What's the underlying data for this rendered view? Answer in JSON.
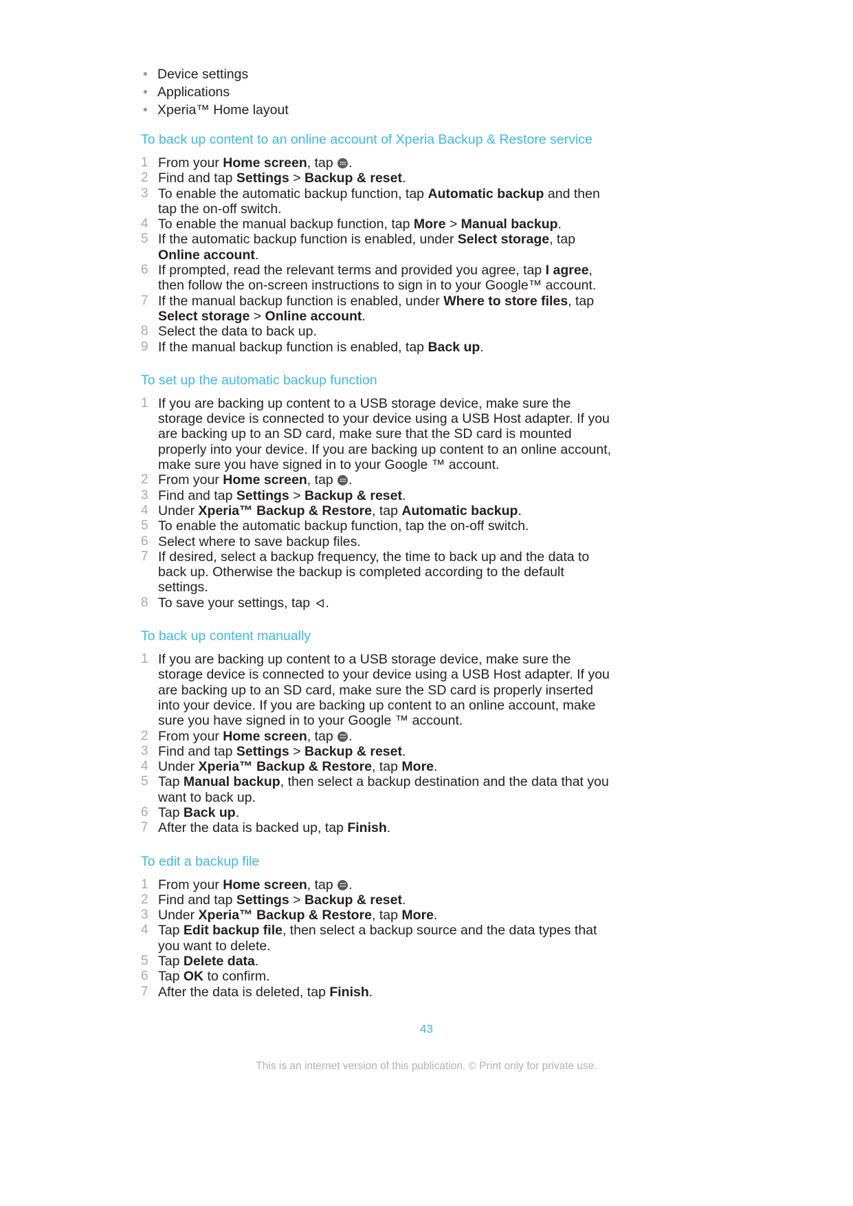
{
  "bullets": [
    "Device settings",
    "Applications",
    "Xperia™ Home layout"
  ],
  "sections": [
    {
      "heading": "To back up content to an online account of Xperia Backup & Restore service",
      "steps": [
        {
          "num": "1",
          "html": "From your <b>Home screen</b>, tap <span class=\"apps-icon\" data-name=\"apps-tray-icon\" data-interactable=\"false\"><i></i><i></i><i></i><i></i><i></i><i></i></span>."
        },
        {
          "num": "2",
          "html": "Find and tap <b>Settings</b> <span class=\"gt\">&gt;</span> <b>Backup &amp; reset</b>."
        },
        {
          "num": "3",
          "html": "To enable the automatic backup function, tap <b>Automatic backup</b> and then tap the on-off switch."
        },
        {
          "num": "4",
          "html": "To enable the manual backup function, tap <b>More</b> <span class=\"gt\">&gt;</span> <b>Manual backup</b>."
        },
        {
          "num": "5",
          "html": "If the automatic backup function is enabled, under <b>Select storage</b>, tap <b>Online account</b>."
        },
        {
          "num": "6",
          "html": "If prompted, read the relevant terms and provided you agree, tap <b>I agree</b>, then follow the on-screen instructions to sign in to your Google™ account."
        },
        {
          "num": "7",
          "html": "If the manual backup function is enabled, under <b>Where to store files</b>, tap <b>Select storage</b> <span class=\"gt\">&gt;</span> <b>Online account</b>."
        },
        {
          "num": "8",
          "html": "Select the data to back up."
        },
        {
          "num": "9",
          "html": "If the manual backup function is enabled, tap <b>Back up</b>."
        }
      ]
    },
    {
      "heading": "To set up the automatic backup function",
      "steps": [
        {
          "num": "1",
          "html": "If you are backing up content to a USB storage device, make sure the storage device is connected to your device using a USB Host adapter. If you are backing up to an SD card, make sure that the SD card is mounted properly into your device. If you are backing up content to an online account, make sure you have signed in to your Google ™ account."
        },
        {
          "num": "2",
          "html": "From your <b>Home screen</b>, tap <span class=\"apps-icon\" data-name=\"apps-tray-icon\" data-interactable=\"false\"><i></i><i></i><i></i><i></i><i></i><i></i></span>."
        },
        {
          "num": "3",
          "html": "Find and tap <b>Settings</b> <span class=\"gt\">&gt;</span> <b>Backup &amp; reset</b>."
        },
        {
          "num": "4",
          "html": "Under <b>Xperia™ Backup &amp; Restore</b>, tap <b>Automatic backup</b>."
        },
        {
          "num": "5",
          "html": "To enable the automatic backup function, tap the on-off switch."
        },
        {
          "num": "6",
          "html": "Select where to save backup files."
        },
        {
          "num": "7",
          "html": "If desired, select a backup frequency, the time to back up and the data to back up. Otherwise the backup is completed according to the default settings."
        },
        {
          "num": "8",
          "html": "To save your settings, tap <svg class=\"back-icon\" data-name=\"back-arrow-icon\" data-interactable=\"false\" width=\"15\" height=\"15\" viewBox=\"0 0 15 15\"><path d=\"M12.2 2.2 L2.6 7.5 L12.2 12.8 Z\" fill=\"none\" stroke=\"#231f20\" stroke-width=\"1.3\" stroke-linejoin=\"round\"/></svg>."
        }
      ]
    },
    {
      "heading": "To back up content manually",
      "steps": [
        {
          "num": "1",
          "html": "If you are backing up content to a USB storage device, make sure the storage device is connected to your device using a USB Host adapter. If you are backing up to an SD card, make sure the SD card is properly inserted into your device. If you are backing up content to an online account, make sure you have signed in to your Google ™ account."
        },
        {
          "num": "2",
          "html": "From your <b>Home screen</b>, tap <span class=\"apps-icon\" data-name=\"apps-tray-icon\" data-interactable=\"false\"><i></i><i></i><i></i><i></i><i></i><i></i></span>."
        },
        {
          "num": "3",
          "html": "Find and tap <b>Settings</b> <span class=\"gt\">&gt;</span> <b>Backup &amp; reset</b>."
        },
        {
          "num": "4",
          "html": "Under <b>Xperia™ Backup &amp; Restore</b>, tap <b>More</b>."
        },
        {
          "num": "5",
          "html": "Tap <b>Manual backup</b>, then select a backup destination and the data that you want to back up."
        },
        {
          "num": "6",
          "html": "Tap <b>Back up</b>."
        },
        {
          "num": "7",
          "html": "After the data is backed up, tap <b>Finish</b>."
        }
      ]
    },
    {
      "heading": "To edit a backup file",
      "steps": [
        {
          "num": "1",
          "html": "From your <b>Home screen</b>, tap <span class=\"apps-icon\" data-name=\"apps-tray-icon\" data-interactable=\"false\"><i></i><i></i><i></i><i></i><i></i><i></i></span>."
        },
        {
          "num": "2",
          "html": "Find and tap <b>Settings</b> <span class=\"gt\">&gt;</span> <b>Backup &amp; reset</b>."
        },
        {
          "num": "3",
          "html": "Under <b>Xperia™ Backup &amp; Restore</b>, tap <b>More</b>."
        },
        {
          "num": "4",
          "html": "Tap <b>Edit backup file</b>, then select a backup source and the data types that you want to delete."
        },
        {
          "num": "5",
          "html": "Tap <b>Delete data</b>."
        },
        {
          "num": "6",
          "html": "Tap <b>OK</b> to confirm."
        },
        {
          "num": "7",
          "html": "After the data is deleted, tap <b>Finish</b>."
        }
      ]
    }
  ],
  "footer": {
    "page_number": "43",
    "disclaimer": "This is an internet version of this publication. © Print only for private use."
  },
  "colors": {
    "heading": "#3bb9e8",
    "body_text": "#231f20",
    "step_number": "#a7a9ac",
    "footer_text": "#b0b2b4"
  }
}
